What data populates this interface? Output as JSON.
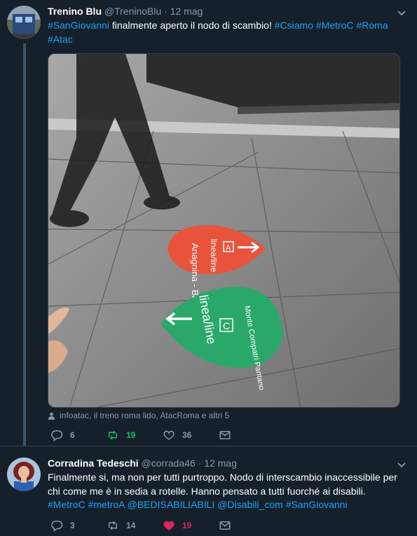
{
  "tweets": [
    {
      "display_name": "Trenino Blu",
      "handle": "@TreninoBlu",
      "separator": " · ",
      "date": "12 mag",
      "text_segments": [
        {
          "text": "#SanGiovanni",
          "hashtag": true
        },
        {
          "text": " finalmente aperto il nodo di scambio! ",
          "hashtag": false
        },
        {
          "text": "#Csiamo",
          "hashtag": true
        },
        {
          "text": " ",
          "hashtag": false
        },
        {
          "text": "#MetroC",
          "hashtag": true
        },
        {
          "text": " ",
          "hashtag": false
        },
        {
          "text": "#Roma",
          "hashtag": true
        },
        {
          "text": " ",
          "hashtag": false
        },
        {
          "text": "#Atac",
          "hashtag": true
        }
      ],
      "photo": {
        "sign_a": {
          "line": "linea/line",
          "letter": "A",
          "dest": "Anagnina - Battistini"
        },
        "sign_c": {
          "line": "linea/line",
          "letter": "C",
          "dest": "Monte Compatri Pantano"
        }
      },
      "tagged_users": "infoatac, il treno roma lido, AtacRoma e altri 5",
      "replies": "6",
      "retweets": "19",
      "likes": "36"
    },
    {
      "display_name": "Corradina Tedeschi",
      "handle": "@corrada46",
      "separator": " · ",
      "date": "12 mag",
      "text_segments": [
        {
          "text": "Finalmente si, ma non per tutti purtroppo. Nodo di interscambio inaccessibile per chi come me è in sedia a rotelle. Hanno pensato a tutti fuorché ai disabili. ",
          "hashtag": false
        },
        {
          "text": "#MetroC",
          "hashtag": true
        },
        {
          "text": " ",
          "hashtag": false
        },
        {
          "text": "#metroA",
          "hashtag": true
        },
        {
          "text": " ",
          "hashtag": false
        },
        {
          "text": "@BEDISABILIABILI",
          "hashtag": true
        },
        {
          "text": " ",
          "hashtag": false
        },
        {
          "text": "@Disabili_com",
          "hashtag": true
        },
        {
          "text": " ",
          "hashtag": false
        },
        {
          "text": "#SanGiovanni",
          "hashtag": true
        }
      ],
      "replies": "3",
      "retweets": "14",
      "likes": "19"
    }
  ],
  "icons": {
    "caret": "chevron-down-icon",
    "reply": "reply-icon",
    "retweet": "retweet-icon",
    "like": "heart-icon",
    "dm": "envelope-icon",
    "tag": "person-icon"
  },
  "colors": {
    "background": "#15202b",
    "link": "#1da1f2",
    "muted": "#8899a6",
    "retweet_active": "#17bf63",
    "like_active": "#e0245e"
  }
}
